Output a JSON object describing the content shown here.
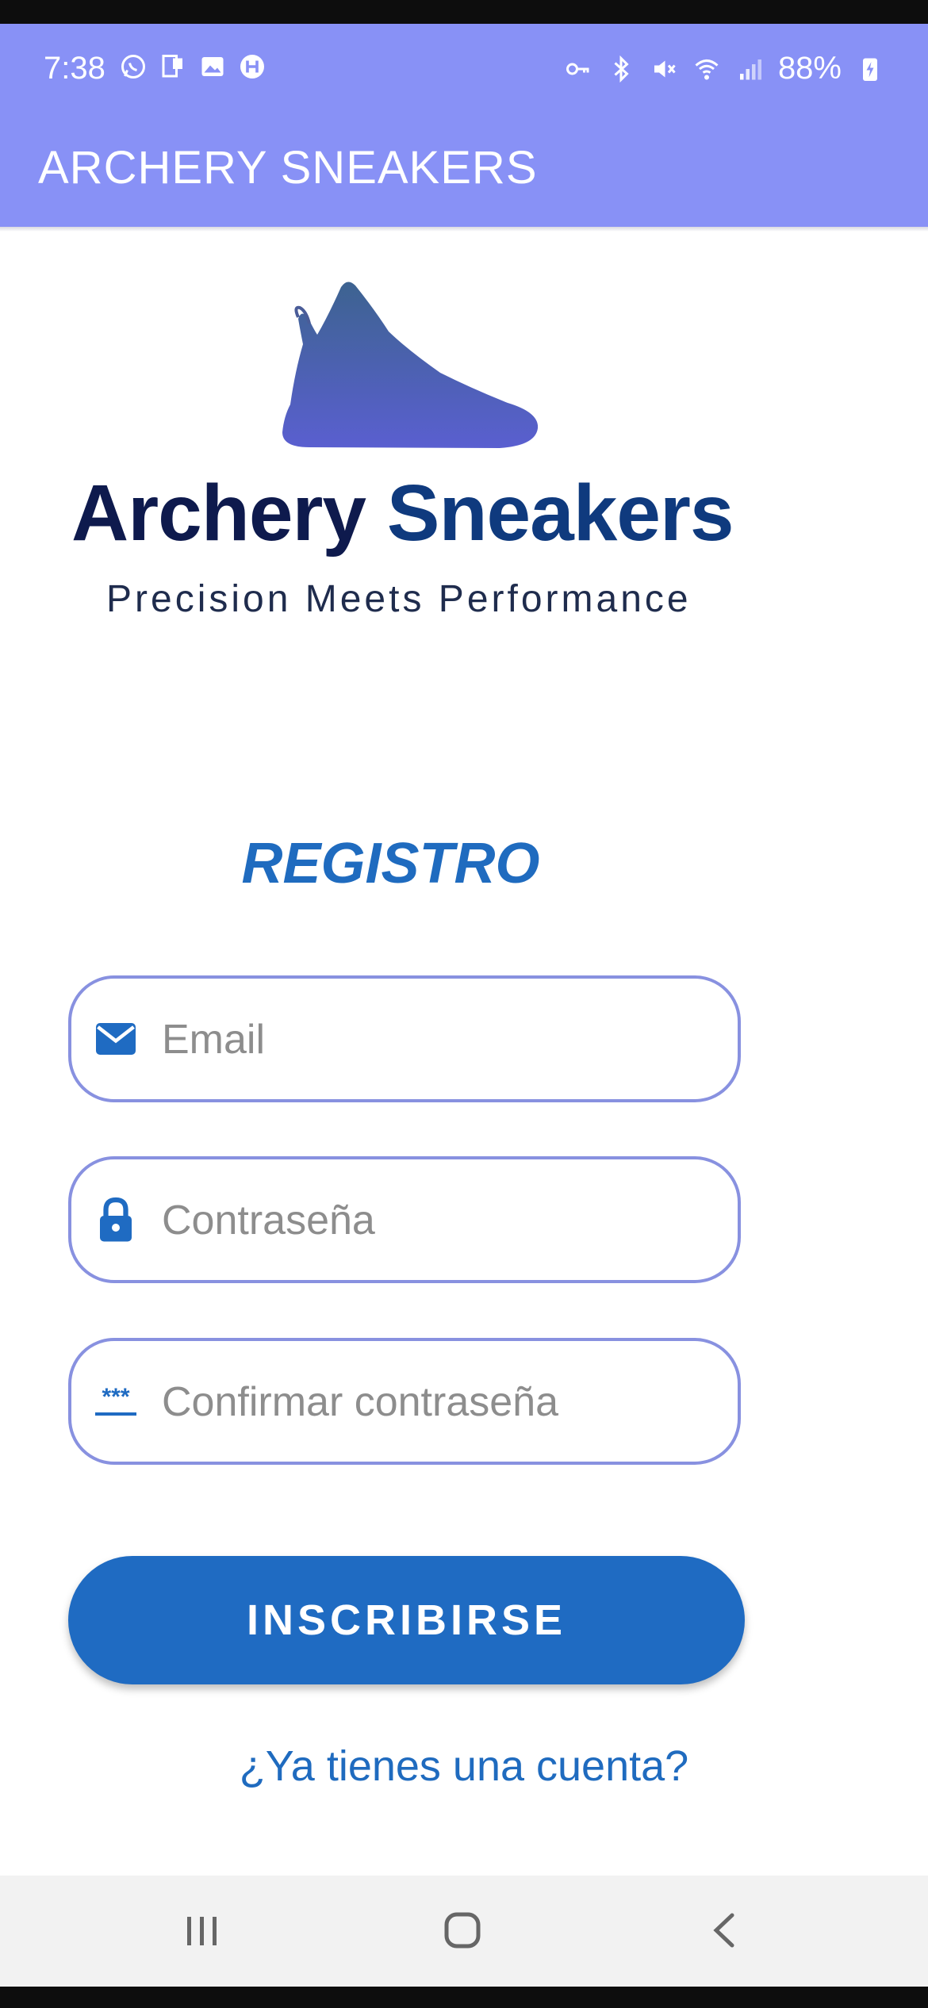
{
  "status_bar": {
    "time": "7:38",
    "battery": "88%",
    "left_icons": [
      "whatsapp-icon",
      "notification-icon",
      "image-icon",
      "app-icon"
    ],
    "right_icons": [
      "key-icon",
      "bluetooth-icon",
      "mute-icon",
      "wifi-icon",
      "signal-icon",
      "battery-icon"
    ],
    "background": "#8891f6"
  },
  "app_bar": {
    "title": "ARCHERY SNEAKERS"
  },
  "logo": {
    "name_part1": "Archery ",
    "name_part2": "Sneakers",
    "tagline": "Precision Meets Performance"
  },
  "form": {
    "title": "REGISTRO",
    "email_placeholder": "Email",
    "password_placeholder": "Contraseña",
    "confirm_placeholder": "Confirmar contraseña",
    "confirm_icon_text": "***",
    "submit_label": "INSCRIBIRSE",
    "login_link": "¿Ya tienes una cuenta?"
  },
  "colors": {
    "accent": "#1f6bc2",
    "field_border": "#8891e0",
    "app_bar": "#8891f6"
  },
  "nav_bar": {
    "icons": [
      "recent-apps-icon",
      "home-icon",
      "back-icon"
    ]
  }
}
